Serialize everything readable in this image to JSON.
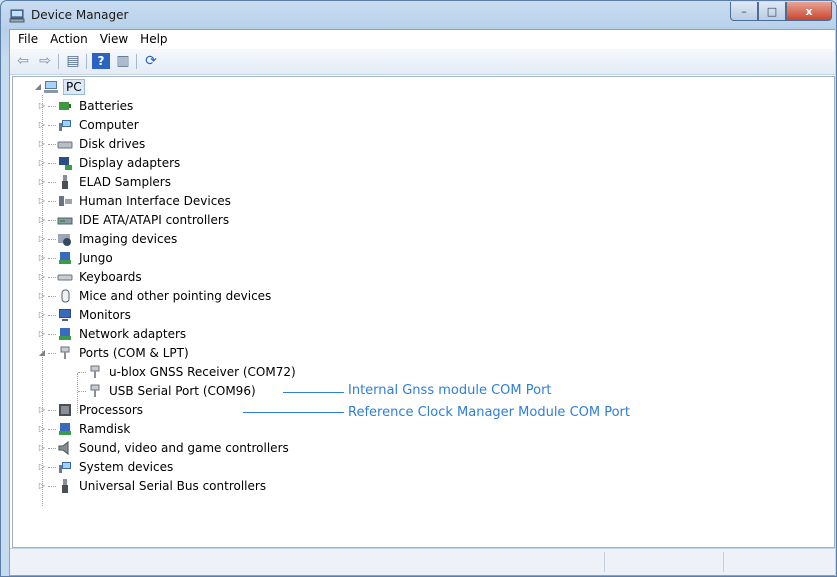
{
  "window": {
    "title": "Device Manager"
  },
  "window_buttons": {
    "minimize": "–",
    "maximize": "□",
    "close": "x"
  },
  "menu": [
    "File",
    "Action",
    "View",
    "Help"
  ],
  "toolbar": [
    {
      "name": "back-icon",
      "glyph": "⇦"
    },
    {
      "name": "forward-icon",
      "glyph": "⇨"
    },
    {
      "name": "properties-icon",
      "glyph": "▤"
    },
    {
      "name": "help-icon",
      "glyph": "?"
    },
    {
      "name": "view-icon",
      "glyph": "▥"
    },
    {
      "name": "scan-hardware-icon",
      "glyph": "⟳"
    }
  ],
  "tree": {
    "root": "PC",
    "categories": [
      {
        "label": "Batteries",
        "icon": "battery-icon"
      },
      {
        "label": "Computer",
        "icon": "computer-icon"
      },
      {
        "label": "Disk drives",
        "icon": "disk-drive-icon"
      },
      {
        "label": "Display adapters",
        "icon": "display-adapter-icon"
      },
      {
        "label": "ELAD Samplers",
        "icon": "usb-device-icon"
      },
      {
        "label": "Human Interface Devices",
        "icon": "hid-icon"
      },
      {
        "label": "IDE ATA/ATAPI controllers",
        "icon": "ide-controller-icon"
      },
      {
        "label": "Imaging devices",
        "icon": "camera-icon"
      },
      {
        "label": "Jungo",
        "icon": "jungo-icon"
      },
      {
        "label": "Keyboards",
        "icon": "keyboard-icon"
      },
      {
        "label": "Mice and other pointing devices",
        "icon": "mouse-icon"
      },
      {
        "label": "Monitors",
        "icon": "monitor-icon"
      },
      {
        "label": "Network adapters",
        "icon": "network-adapter-icon"
      },
      {
        "label": "Ports (COM & LPT)",
        "icon": "port-icon",
        "expanded": true
      },
      {
        "label": "Processors",
        "icon": "processor-icon"
      },
      {
        "label": "Ramdisk",
        "icon": "ramdisk-icon"
      },
      {
        "label": "Sound, video and game controllers",
        "icon": "speaker-icon"
      },
      {
        "label": "System devices",
        "icon": "system-device-icon"
      },
      {
        "label": "Universal Serial Bus controllers",
        "icon": "usb-controller-icon"
      }
    ],
    "ports": [
      {
        "label": "u-blox GNSS Receiver (COM72)",
        "icon": "port-icon"
      },
      {
        "label": "USB Serial Port (COM96)",
        "icon": "port-icon"
      }
    ]
  },
  "annotations": [
    "Internal Gnss module COM Port",
    "Reference Clock Manager Module COM Port"
  ],
  "colors": {
    "annotation": "#2f7ed8",
    "selection": "#dce8f7"
  }
}
